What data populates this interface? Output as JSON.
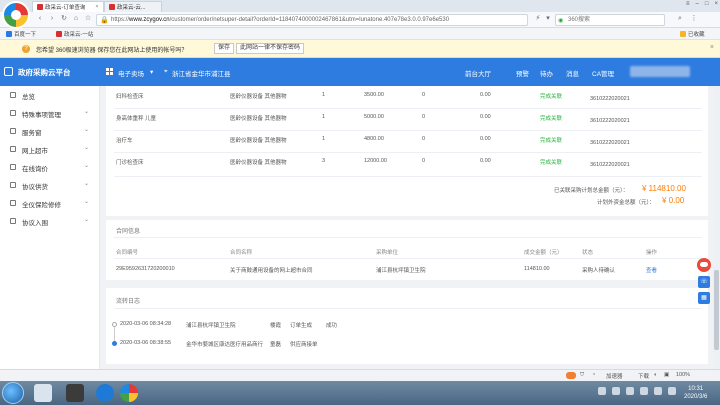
{
  "browser": {
    "tabs": [
      {
        "label": "政采云-订单查询",
        "active": true
      },
      {
        "label": "政采云-云...",
        "active": false
      }
    ],
    "url_prefix": "https://",
    "url_domain": "www.zcygov.cn",
    "url_rest": "/customer/order/netsuper-detail?orderId=1184074000002467861&utm=lunatone.407e78e3.0.0.97e6e530",
    "search_placeholder": "360搜索",
    "favorites": [
      "百度一下",
      "政采云-一站"
    ],
    "favorites_right": "已收藏"
  },
  "notice": {
    "text": "您希望 360极速浏览器 保存您在此网站上使用的帐号吗？",
    "save_button": "保存",
    "never_button": "此网站一律不保存密码"
  },
  "header": {
    "title": "政府采购云平台",
    "menu": "电子卖场",
    "location": "浙江省金华市浦江县",
    "nav": [
      "前台大厅",
      "预警",
      "待办",
      "消息",
      "CA管理"
    ]
  },
  "sidebar": {
    "items": [
      {
        "label": "总览",
        "arrow": ""
      },
      {
        "label": "特殊事项管理",
        "arrow": "⌄"
      },
      {
        "label": "服务窗",
        "arrow": "⌄"
      },
      {
        "label": "网上超市",
        "arrow": "⌄"
      },
      {
        "label": "在线询价",
        "arrow": "⌄"
      },
      {
        "label": "协议供货",
        "arrow": "⌄"
      },
      {
        "label": "全仪保险修修",
        "arrow": "⌄"
      },
      {
        "label": "协议入围",
        "arrow": "⌄"
      }
    ]
  },
  "items_table": {
    "rows": [
      {
        "name": "妇科检查床",
        "category": "医龄仪器设备 其他器物",
        "qty": "1",
        "price": "3500.00",
        "a": "0",
        "b": "0.00",
        "status": "完成关联",
        "code": "3610222020021"
      },
      {
        "name": "身高体重秤 儿童",
        "category": "医龄仪器设备 其他器物",
        "qty": "1",
        "price": "5000.00",
        "a": "0",
        "b": "0.00",
        "status": "完成关联",
        "code": "3610222020021"
      },
      {
        "name": "治疗车",
        "category": "医龄仪器设备 其他器物",
        "qty": "1",
        "price": "4800.00",
        "a": "0",
        "b": "0.00",
        "status": "完成关联",
        "code": "3610222020021"
      },
      {
        "name": "门诊检查床",
        "category": "医龄仪器设备 其他器物",
        "qty": "3",
        "price": "12000.00",
        "a": "0",
        "b": "0.00",
        "status": "完成关联",
        "code": "3610222020021"
      }
    ],
    "total_label": "已关联采购计划总金额（元）：",
    "total_value": "¥ 114810.00",
    "budget_label": "计划外资金总额（元）：",
    "budget_value": "¥ 0.00"
  },
  "contract": {
    "title": "合同信息",
    "headers": [
      "合同编号",
      "合同名称",
      "采购单位",
      "成交金额（元）",
      "状态",
      "操作"
    ],
    "row": {
      "no": "29E9592631720200010",
      "name": "关于商鼓通用设备的网上超市合同",
      "buyer": "浦江县杭坪镇卫生院",
      "amount": "114810.00",
      "status": "采购人待确认",
      "action": "查看"
    }
  },
  "log": {
    "title": "流转日志",
    "entries": [
      {
        "time": "2020-03-06 08:34:28",
        "org": "浦江县杭坪镇卫生院",
        "user": "楼霞",
        "action": "订单生成",
        "result": "成功"
      },
      {
        "time": "2020-03-06 08:38:55",
        "org": "金华市婺城区康达医疗用品商行",
        "user": "童磊",
        "action": "供应商接单",
        "result": ""
      }
    ]
  },
  "statusbar": {
    "right": [
      "加速器",
      "下载"
    ],
    "zoom": "100%"
  },
  "taskbar": {
    "time": "10:31",
    "date": "2020/3/6"
  },
  "colors": {
    "brand": "#2f7ce0",
    "success": "#26b33f",
    "amount": "#ff7b00"
  }
}
